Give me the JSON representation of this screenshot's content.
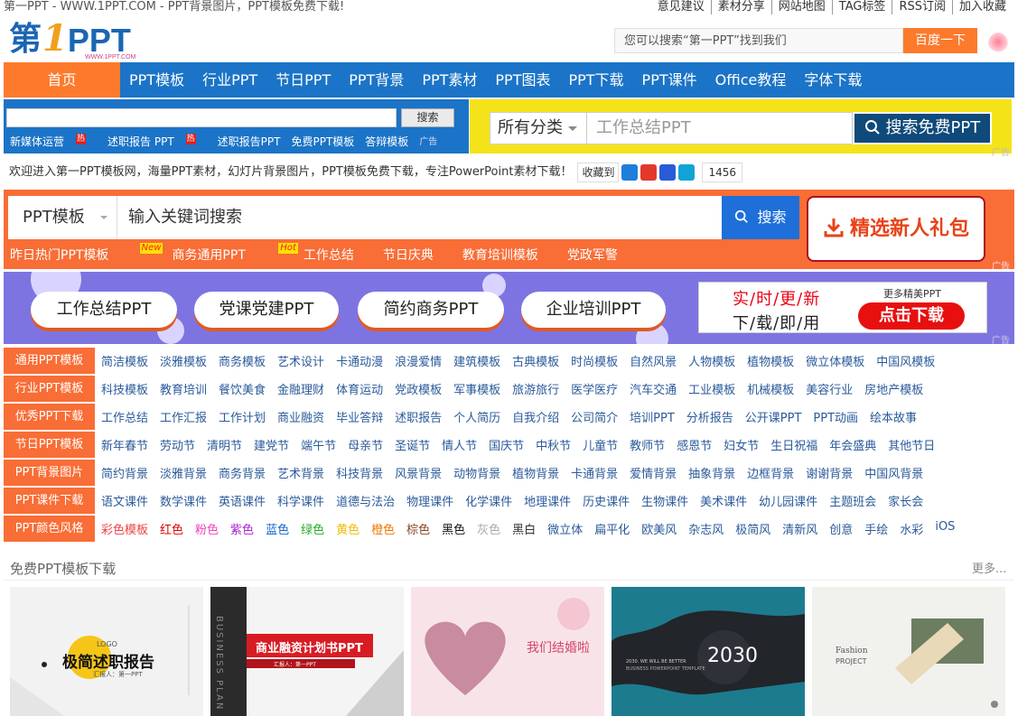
{
  "topbar": {
    "tagline": "第一PPT - WWW.1PPT.COM - PPT背景图片，PPT模板免费下载!",
    "links": [
      "意见建议",
      "素材分享",
      "网站地图",
      "TAG标签",
      "RSS订阅",
      "加入收藏"
    ]
  },
  "logo": {
    "part1": "第",
    "part2": "1",
    "part3": "PPT",
    "sub": "WWW.1PPT.COM"
  },
  "baidu": {
    "placeholder": "您可以搜索“第一PPT”找到我们",
    "button": "百度一下"
  },
  "nav": {
    "home": "首页",
    "items": [
      "PPT模板",
      "行业PPT",
      "节日PPT",
      "PPT背景",
      "PPT素材",
      "PPT图表",
      "PPT下载",
      "PPT课件",
      "Office教程",
      "字体下载"
    ]
  },
  "ad_search": {
    "button": "搜索",
    "hot_links": [
      {
        "label": "新媒体运营",
        "badge": "热"
      },
      {
        "label": "述职报告 PPT",
        "badge": "热"
      },
      {
        "label": "述职报告PPT",
        "badge": ""
      },
      {
        "label": "免费PPT模板",
        "badge": ""
      },
      {
        "label": "答辩模板",
        "badge": ""
      }
    ],
    "ad_mark": "广告"
  },
  "yellow_search": {
    "category": "所有分类",
    "placeholder": "工作总结PPT",
    "button": "搜索免费PPT",
    "ad_mark": "广告"
  },
  "welcome": {
    "text": "欢迎进入第一PPT模板网，海量PPT素材，幻灯片背景图片，PPT模板免费下载，专注PowerPoint素材下载！",
    "favorite": "收藏到",
    "count": "1456"
  },
  "orange_search": {
    "category": "PPT模板",
    "placeholder": "输入关键词搜索",
    "button": "搜索",
    "gift": "精选新人礼包",
    "tags": [
      {
        "label": "昨日热门PPT模板",
        "badge": "New"
      },
      {
        "label": "商务通用PPT",
        "badge": "Hot"
      },
      {
        "label": "工作总结",
        "badge": ""
      },
      {
        "label": "节日庆典",
        "badge": ""
      },
      {
        "label": "教育培训模板",
        "badge": ""
      },
      {
        "label": "党政军警",
        "badge": ""
      }
    ],
    "ad_mark": "广告"
  },
  "purple_banner": {
    "pills": [
      "工作总结PPT",
      "党课党建PPT",
      "简约商务PPT",
      "企业培训PPT"
    ],
    "promo_line1": "实/时/更/新",
    "promo_line2": "下/载/即/用",
    "promo_more": "更多精美PPT",
    "promo_button": "点击下载",
    "ad_mark": "广告"
  },
  "categories": [
    {
      "label": "通用PPT模板",
      "links": [
        "简洁模板",
        "淡雅模板",
        "商务模板",
        "艺术设计",
        "卡通动漫",
        "浪漫爱情",
        "建筑模板",
        "古典模板",
        "时尚模板",
        "自然风景",
        "人物模板",
        "植物模板",
        "微立体模板",
        "中国风模板"
      ]
    },
    {
      "label": "行业PPT模板",
      "links": [
        "科技模板",
        "教育培训",
        "餐饮美食",
        "金融理财",
        "体育运动",
        "党政模板",
        "军事模板",
        "旅游旅行",
        "医学医疗",
        "汽车交通",
        "工业模板",
        "机械模板",
        "美容行业",
        "房地产模板"
      ]
    },
    {
      "label": "优秀PPT下载",
      "links": [
        "工作总结",
        "工作汇报",
        "工作计划",
        "商业融资",
        "毕业答辩",
        "述职报告",
        "个人简历",
        "自我介绍",
        "公司简介",
        "培训PPT",
        "分析报告",
        "公开课PPT",
        "PPT动画",
        "绘本故事"
      ]
    },
    {
      "label": "节日PPT模板",
      "links": [
        "新年春节",
        "劳动节",
        "清明节",
        "建党节",
        "端午节",
        "母亲节",
        "圣诞节",
        "情人节",
        "国庆节",
        "中秋节",
        "儿童节",
        "教师节",
        "感恩节",
        "妇女节",
        "生日祝福",
        "年会盛典",
        "其他节日"
      ]
    },
    {
      "label": "PPT背景图片",
      "links": [
        "简约背景",
        "淡雅背景",
        "商务背景",
        "艺术背景",
        "科技背景",
        "风景背景",
        "动物背景",
        "植物背景",
        "卡通背景",
        "爱情背景",
        "抽象背景",
        "边框背景",
        "谢谢背景",
        "中国风背景"
      ]
    },
    {
      "label": "PPT课件下载",
      "links": [
        "语文课件",
        "数学课件",
        "英语课件",
        "科学课件",
        "道德与法治",
        "物理课件",
        "化学课件",
        "地理课件",
        "历史课件",
        "生物课件",
        "美术课件",
        "幼儿园课件",
        "主题班会",
        "家长会"
      ]
    },
    {
      "label": "PPT颜色风格",
      "links": [
        "彩色模板",
        "红色",
        "粉色",
        "紫色",
        "蓝色",
        "绿色",
        "黄色",
        "橙色",
        "棕色",
        "黑色",
        "灰色",
        "黑白",
        "微立体",
        "扁平化",
        "欧美风",
        "杂志风",
        "极简风",
        "清新风",
        "创意",
        "手绘",
        "水彩",
        "iOS"
      ]
    }
  ],
  "color_styles": [
    "#e44",
    "#d00",
    "#e4b",
    "#a2c",
    "#16c",
    "#2a2",
    "#eb0",
    "#e70",
    "#842",
    "#111",
    "#aaa",
    "#333"
  ],
  "free_section": {
    "title": "免费PPT模板下载",
    "more": "更多..."
  },
  "thumbnails": [
    {
      "title": "极简述职报告",
      "sub": "汇报人：第一PPT",
      "tag": "LOGO",
      "bg": "#f2f2f2"
    },
    {
      "title": "商业融资计划书PPT",
      "side": "BUSINESS PLAN",
      "sub": "汇报人：第一PPT",
      "bg": "#f4f4f4"
    },
    {
      "title": "我们结婚啦",
      "bg": "#f8e4e8"
    },
    {
      "title": "2030",
      "sub": "2030. WE WILL BE BETTER",
      "sub2": "BUSINESS POWERPOINT TEMPLATE",
      "bg": "#1e6475"
    },
    {
      "title": "Fashion",
      "sub": "PROJECT",
      "bg": "#f1f1ee"
    }
  ]
}
